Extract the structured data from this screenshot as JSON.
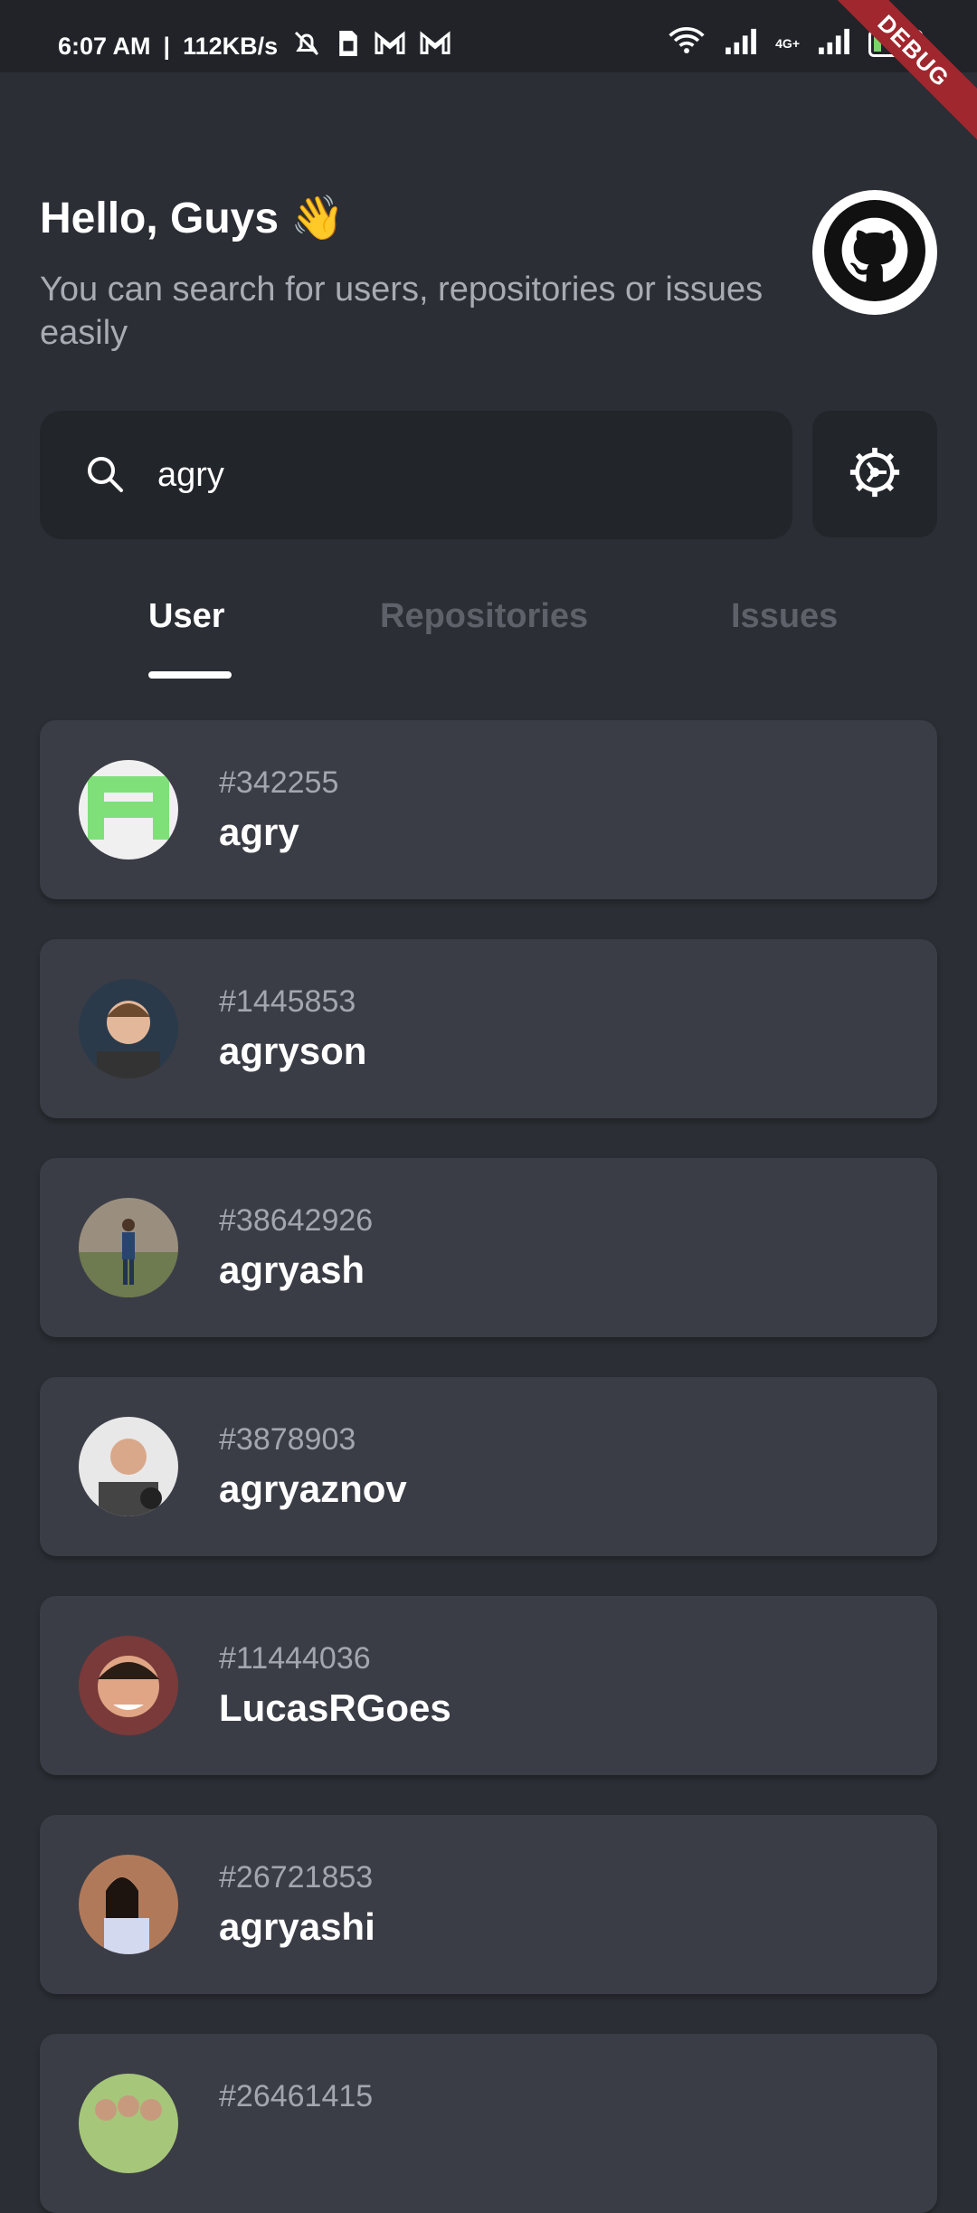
{
  "status_bar": {
    "time": "6:07 AM",
    "speed": "112KB/s",
    "network": "4G+",
    "battery": "10",
    "icons": [
      "mute-icon",
      "sim-icon",
      "gmail-icon",
      "gmail-icon",
      "wifi-icon",
      "signal-icon",
      "signal-icon",
      "battery-icon"
    ]
  },
  "debug_ribbon": "DEBUG",
  "header": {
    "greeting": "Hello, Guys 👋",
    "subtitle": "You can search for users, repositories or issues easily",
    "avatar_icon": "github-icon"
  },
  "search": {
    "value": "agry",
    "icon": "search-icon"
  },
  "settings_icon": "gear-icon",
  "tabs": [
    {
      "label": "User",
      "active": true
    },
    {
      "label": "Repositories",
      "active": false
    },
    {
      "label": "Issues",
      "active": false
    }
  ],
  "users": [
    {
      "id": "#342255",
      "name": "agry"
    },
    {
      "id": "#1445853",
      "name": "agryson"
    },
    {
      "id": "#38642926",
      "name": "agryash"
    },
    {
      "id": "#3878903",
      "name": "agryaznov"
    },
    {
      "id": "#11444036",
      "name": "LucasRGoes"
    },
    {
      "id": "#26721853",
      "name": "agryashi"
    },
    {
      "id": "#26461415",
      "name": ""
    }
  ],
  "colors": {
    "background": "#2b2e34",
    "card": "#3b3d46",
    "input": "#22252a",
    "muted_text": "#a8abb3",
    "inactive_tab": "#5e6169",
    "debug_banner": "#a0272e"
  }
}
